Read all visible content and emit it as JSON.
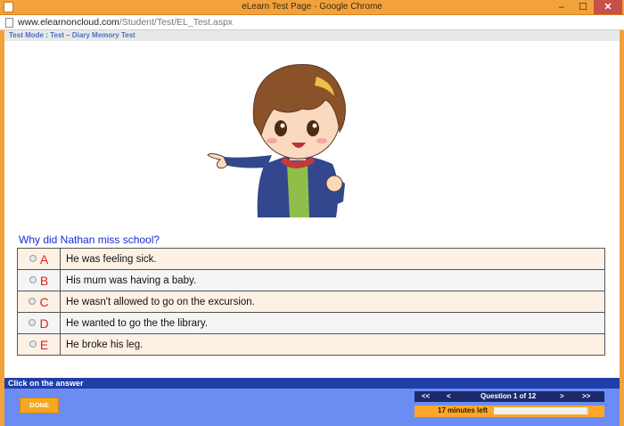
{
  "window": {
    "title": "eLearn Test Page - Google Chrome",
    "url_host": "www.elearnoncloud.com",
    "url_path": "/Student/Test/EL_Test.aspx",
    "min_symbol": "–",
    "max_symbol": "☐",
    "close_symbol": "✕"
  },
  "mode_label": "Test Mode : Test – Diary Memory Test",
  "question": "Why did Nathan miss school?",
  "answers": [
    {
      "letter": "A",
      "text": "He was feeling sick."
    },
    {
      "letter": "B",
      "text": "His mum was having a baby."
    },
    {
      "letter": "C",
      "text": "He wasn't allowed to go on the excursion."
    },
    {
      "letter": "D",
      "text": "He wanted to go the the library."
    },
    {
      "letter": "E",
      "text": "He broke his leg."
    }
  ],
  "footer": {
    "instruction": "Click on the answer",
    "done_label": "DONE",
    "nav": {
      "first": "<<",
      "prev": "<",
      "position": "Question 1 of 12",
      "next": ">",
      "last": ">>"
    },
    "time_left": "17 minutes left",
    "time_progress": 0.98
  },
  "colors": {
    "frame": "#f2a23c",
    "question_text": "#1a2cd6",
    "answer_letter": "#e02020",
    "footer_bg": "#6b8cf3",
    "done_button": "#f6a623"
  },
  "icons": {
    "window_icon": "document-icon",
    "answer_option": "radio-icon"
  }
}
